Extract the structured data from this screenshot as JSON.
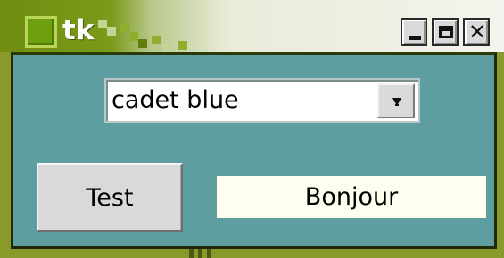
{
  "window": {
    "title": "tk",
    "icon": "app-icon",
    "controls": {
      "minimize_icon": "minimize-icon",
      "maximize_icon": "maximize-icon",
      "close_icon": "close-icon",
      "close_glyph": "✕"
    }
  },
  "combobox": {
    "value": "cadet blue",
    "arrow_icon": "chevron-down-icon"
  },
  "test_button": {
    "label": "Test"
  },
  "output_label": {
    "text": "Bonjour"
  },
  "colors": {
    "client_background": "#5f9ea0",
    "label_background": "#fffff0",
    "titlebar_accent": "#6f8e10"
  }
}
